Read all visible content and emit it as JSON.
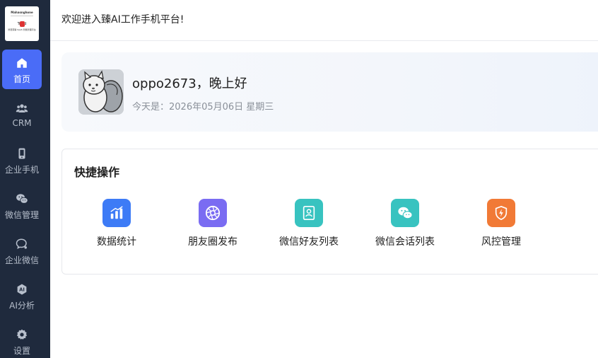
{
  "header": {
    "title": "欢迎进入臻AI工作手机平台!"
  },
  "logo": {
    "line1": "Mahasnghone",
    "line2": "Tr  r  d",
    "line3": "智慧营销 SaaS 智能管理平台"
  },
  "sidebar": {
    "items": [
      {
        "label": "首页",
        "icon": "home-icon",
        "active": true
      },
      {
        "label": "CRM",
        "icon": "users-icon",
        "active": false
      },
      {
        "label": "企业手机",
        "icon": "phone-icon",
        "active": false
      },
      {
        "label": "微信管理",
        "icon": "wechat-icon",
        "active": false
      },
      {
        "label": "企业微信",
        "icon": "work-wechat-icon",
        "active": false
      },
      {
        "label": "AI分析",
        "icon": "ai-icon",
        "active": false
      },
      {
        "label": "设置",
        "icon": "gear-icon",
        "active": false
      }
    ]
  },
  "greeting": {
    "name": "oppo2673，晚上好",
    "date": "今天是：2026年05月06日 星期三"
  },
  "quick_actions": {
    "title": "快捷操作",
    "items": [
      {
        "label": "数据统计",
        "icon": "bar-chart-icon",
        "color": "#3d7bf6"
      },
      {
        "label": "朋友圈发布",
        "icon": "aperture-icon",
        "color": "#7a6cf2"
      },
      {
        "label": "微信好友列表",
        "icon": "contacts-icon",
        "color": "#38c3c0"
      },
      {
        "label": "微信会话列表",
        "icon": "wechat-chat-icon",
        "color": "#38c3c0"
      },
      {
        "label": "风控管理",
        "icon": "shield-icon",
        "color": "#f17a36"
      }
    ]
  },
  "colors": {
    "sidebar_bg": "#1f2a3d",
    "accent": "#4a6cf7"
  }
}
